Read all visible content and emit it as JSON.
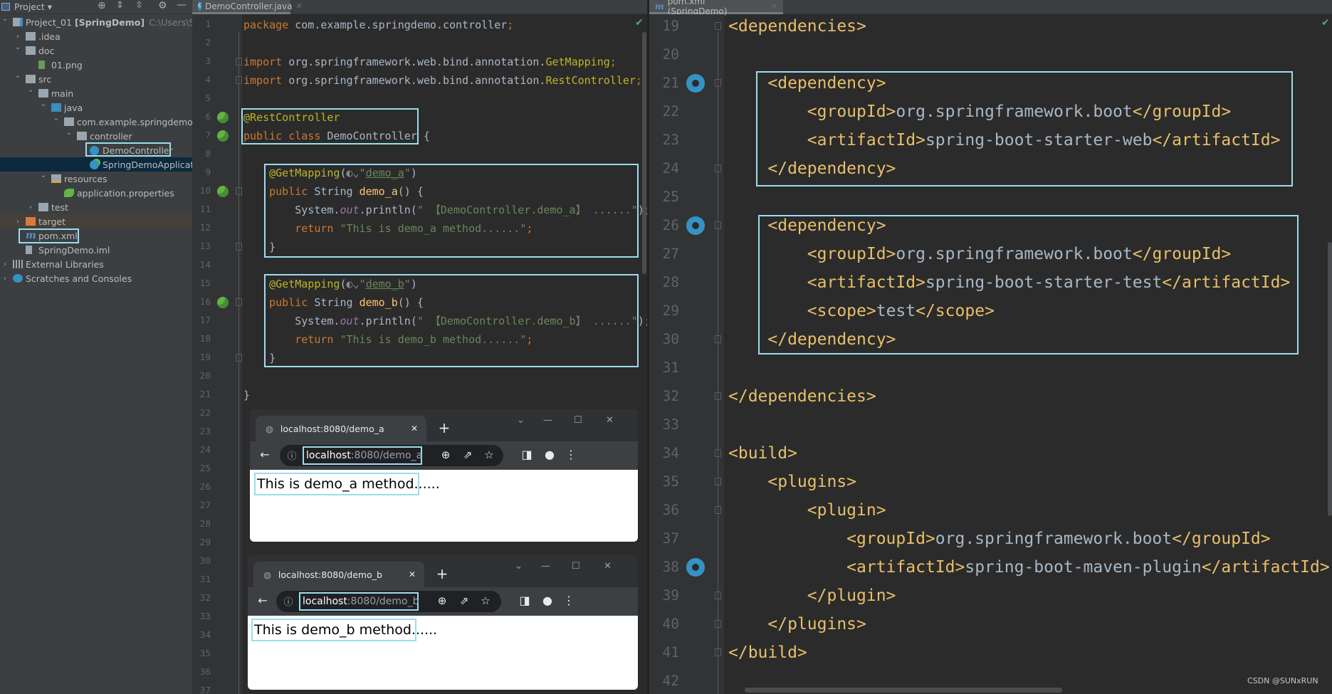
{
  "project_panel": {
    "title": "Project",
    "tree": [
      {
        "level": 0,
        "arrow": "down",
        "icon": "module-folder",
        "label": "Project_01",
        "bold": "[SpringDemo]",
        "path": "C:\\Users\\SUN"
      },
      {
        "level": 1,
        "arrow": "right",
        "icon": "folder",
        "label": ".idea"
      },
      {
        "level": 1,
        "arrow": "down",
        "icon": "folder",
        "label": "doc"
      },
      {
        "level": 2,
        "arrow": null,
        "icon": "image-file",
        "label": "01.png"
      },
      {
        "level": 1,
        "arrow": "down",
        "icon": "folder",
        "label": "src"
      },
      {
        "level": 2,
        "arrow": "down",
        "icon": "folder",
        "label": "main"
      },
      {
        "level": 3,
        "arrow": "down",
        "icon": "source-folder",
        "label": "java"
      },
      {
        "level": 4,
        "arrow": "down",
        "icon": "package",
        "label": "com.example.springdemo"
      },
      {
        "level": 5,
        "arrow": "down",
        "icon": "package",
        "label": "controller"
      },
      {
        "level": 6,
        "arrow": null,
        "icon": "class",
        "label": "DemoController",
        "highlight": true
      },
      {
        "level": 6,
        "arrow": null,
        "icon": "spring-app",
        "label": "SpringDemoApplication",
        "selected": true
      },
      {
        "level": 3,
        "arrow": "down",
        "icon": "resources-folder",
        "label": "resources"
      },
      {
        "level": 4,
        "arrow": null,
        "icon": "properties",
        "label": "application.properties"
      },
      {
        "level": 2,
        "arrow": "right",
        "icon": "folder",
        "label": "test"
      },
      {
        "level": 1,
        "arrow": "right",
        "icon": "excluded-folder",
        "label": "target",
        "excluded": true
      },
      {
        "level": 1,
        "arrow": null,
        "icon": "maven",
        "label": "pom.xml",
        "highlight": true
      },
      {
        "level": 1,
        "arrow": null,
        "icon": "iml-file",
        "label": "SpringDemo.iml"
      },
      {
        "level": 0,
        "arrow": "right",
        "icon": "libraries",
        "label": "External Libraries"
      },
      {
        "level": 0,
        "arrow": "right",
        "icon": "scratches",
        "label": "Scratches and Consoles"
      }
    ]
  },
  "left_editor": {
    "tab": "DemoController.java",
    "line_count": 37,
    "lines": [
      [
        [
          "kw",
          "package "
        ],
        [
          "pl",
          "com.example.springdemo.controller"
        ],
        [
          "kw",
          ";"
        ]
      ],
      [],
      [
        [
          "kw",
          "import "
        ],
        [
          "pl",
          "org.springframework.web.bind.annotation."
        ],
        [
          "ann",
          "GetMapping"
        ],
        [
          "kw",
          ";"
        ]
      ],
      [
        [
          "kw",
          "import "
        ],
        [
          "pl",
          "org.springframework.web.bind.annotation."
        ],
        [
          "ann",
          "RestController"
        ],
        [
          "kw",
          ";"
        ]
      ],
      [],
      [
        [
          "ann",
          "@RestController"
        ]
      ],
      [
        [
          "kw",
          "public class "
        ],
        [
          "pl",
          "DemoController {"
        ]
      ],
      [],
      [
        [
          "ann",
          "    @GetMapping"
        ],
        [
          "pl",
          "("
        ],
        [
          "glob",
          "◐⌄"
        ],
        [
          "str",
          "\""
        ],
        [
          "url",
          "demo_a"
        ],
        [
          "str",
          "\""
        ],
        [
          "pl",
          ")"
        ]
      ],
      [
        [
          "kw",
          "    public "
        ],
        [
          "pl",
          "String "
        ],
        [
          "fn",
          "demo_a"
        ],
        [
          "pl",
          "() {"
        ]
      ],
      [
        [
          "pl",
          "        System."
        ],
        [
          "fld",
          "out"
        ],
        [
          "pl",
          ".println("
        ],
        [
          "str",
          "\" 【DemoController.demo_a】 ......\""
        ],
        [
          "pl",
          ")"
        ],
        [
          "kw",
          ";"
        ]
      ],
      [
        [
          "kw",
          "        return "
        ],
        [
          "str",
          "\"This is demo_a method......\""
        ],
        [
          "kw",
          ";"
        ]
      ],
      [
        [
          "pl",
          "    }"
        ]
      ],
      [],
      [
        [
          "ann",
          "    @GetMapping"
        ],
        [
          "pl",
          "("
        ],
        [
          "glob",
          "◐⌄"
        ],
        [
          "str",
          "\""
        ],
        [
          "url",
          "demo_b"
        ],
        [
          "str",
          "\""
        ],
        [
          "pl",
          ")"
        ]
      ],
      [
        [
          "kw",
          "    public "
        ],
        [
          "pl",
          "String "
        ],
        [
          "fn",
          "demo_b"
        ],
        [
          "pl",
          "() {"
        ]
      ],
      [
        [
          "pl",
          "        System."
        ],
        [
          "fld",
          "out"
        ],
        [
          "pl",
          ".println("
        ],
        [
          "str",
          "\" 【DemoController.demo_b】 ......\""
        ],
        [
          "pl",
          ")"
        ],
        [
          "kw",
          ";"
        ]
      ],
      [
        [
          "kw",
          "        return "
        ],
        [
          "str",
          "\"This is demo_b method......\""
        ],
        [
          "kw",
          ";"
        ]
      ],
      [
        [
          "pl",
          "    }"
        ]
      ],
      [],
      [
        [
          "pl",
          "}"
        ]
      ]
    ]
  },
  "right_editor": {
    "tab": "pom.xml (SpringDemo)",
    "first_line": 19,
    "lines": [
      [
        [
          "tag",
          "<dependencies>"
        ]
      ],
      [],
      [
        [
          "tag",
          "    <dependency>"
        ]
      ],
      [
        [
          "tag",
          "        <groupId>"
        ],
        [
          "txt",
          "org.springframework.boot"
        ],
        [
          "tag",
          "</groupId>"
        ]
      ],
      [
        [
          "tag",
          "        <artifactId>"
        ],
        [
          "txt",
          "spring-boot-starter-web"
        ],
        [
          "tag",
          "</artifactId>"
        ]
      ],
      [
        [
          "tag",
          "    </dependency>"
        ]
      ],
      [],
      [
        [
          "tag",
          "    <dependency>"
        ]
      ],
      [
        [
          "tag",
          "        <groupId>"
        ],
        [
          "txt",
          "org.springframework.boot"
        ],
        [
          "tag",
          "</groupId>"
        ]
      ],
      [
        [
          "tag",
          "        <artifactId>"
        ],
        [
          "txt",
          "spring-boot-starter-test"
        ],
        [
          "tag",
          "</artifactId>"
        ]
      ],
      [
        [
          "tag",
          "        <scope>"
        ],
        [
          "txt",
          "test"
        ],
        [
          "tag",
          "</scope>"
        ]
      ],
      [
        [
          "tag",
          "    </dependency>"
        ]
      ],
      [],
      [
        [
          "tag",
          "</dependencies>"
        ]
      ],
      [],
      [
        [
          "tag",
          "<build>"
        ]
      ],
      [
        [
          "tag",
          "    <plugins>"
        ]
      ],
      [
        [
          "tag",
          "        <plugin>"
        ]
      ],
      [
        [
          "tag",
          "            <groupId>"
        ],
        [
          "txt",
          "org.springframework.boot"
        ],
        [
          "tag",
          "</groupId>"
        ]
      ],
      [
        [
          "tag",
          "            <artifactId>"
        ],
        [
          "txt",
          "spring-boot-maven-plugin"
        ],
        [
          "tag",
          "</artifactId>"
        ]
      ],
      [
        [
          "tag",
          "        </plugin>"
        ]
      ],
      [
        [
          "tag",
          "    </plugins>"
        ]
      ],
      [
        [
          "tag",
          "</build>"
        ]
      ],
      []
    ]
  },
  "browsers": [
    {
      "tab_title": "localhost:8080/demo_a",
      "url_host": "localhost",
      "url_rest": ":8080/demo_a",
      "content": "This is demo_a method......"
    },
    {
      "tab_title": "localhost:8080/demo_b",
      "url_host": "localhost",
      "url_rest": ":8080/demo_b",
      "content": "This is demo_b method......"
    }
  ],
  "watermark": "CSDN @SUNxRUN",
  "colors": {
    "highlight_box": "#9cdcf0",
    "keyword": "#cc7832",
    "annotation": "#bbb529",
    "string": "#6a8759",
    "xml_tag": "#e8bf6a"
  }
}
